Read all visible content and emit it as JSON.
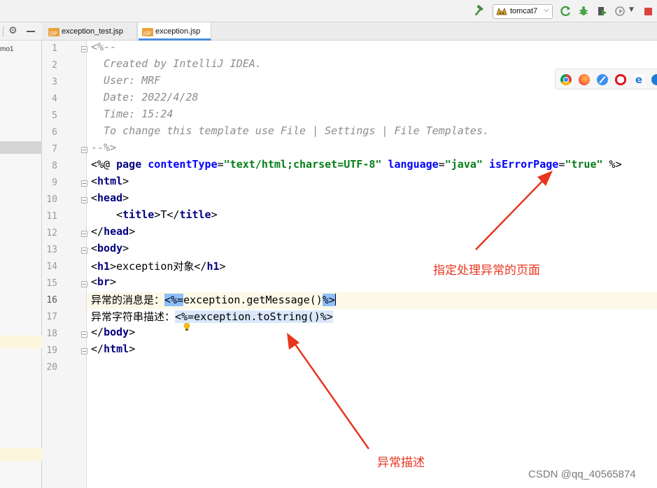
{
  "toolbar": {
    "run_config": "tomcat7",
    "icons": [
      "build-hammer-icon",
      "tomcat-icon",
      "rerun-icon",
      "debug-icon",
      "coverage-icon",
      "profile-icon",
      "stop-icon"
    ],
    "stop_color": "#d9453d"
  },
  "project_panel": {
    "item_fragment": "mo1"
  },
  "tabs": [
    {
      "label": "exception_test.jsp",
      "active": false
    },
    {
      "label": "exception.jsp",
      "active": true
    }
  ],
  "editor": {
    "line_numbers": [
      "1",
      "2",
      "3",
      "4",
      "5",
      "6",
      "7",
      "8",
      "9",
      "10",
      "11",
      "12",
      "13",
      "14",
      "15",
      "16",
      "17",
      "18",
      "19",
      "20"
    ],
    "current_line": "16",
    "lines": {
      "l1": "<%--",
      "l2": "  Created by IntelliJ IDEA.",
      "l3": "  User: MRF",
      "l4": "  Date: 2022/4/28",
      "l5": "  Time: 15:24",
      "l6": "  To change this template use File | Settings | File Templates.",
      "l7": "--%>",
      "l8": {
        "open": "<%@ ",
        "kw": "page",
        "a1": " contentType",
        "eq1": "=",
        "v1": "\"text/html;charset=UTF-8\"",
        "a2": " language",
        "eq2": "=",
        "v2": "\"java\"",
        "a3": " isErrorPage",
        "eq3": "=",
        "v3": "\"true\"",
        "close": " %>"
      },
      "l9": {
        "lt": "<",
        "tag": "html",
        "gt": ">"
      },
      "l10": {
        "lt": "<",
        "tag": "head",
        "gt": ">"
      },
      "l11": {
        "indent": "    ",
        "lt": "<",
        "tag": "title",
        "gt": ">",
        "text": "T",
        "lt2": "</",
        "tag2": "title",
        "gt2": ">"
      },
      "l12": {
        "lt": "</",
        "tag": "head",
        "gt": ">"
      },
      "l13": {
        "lt": "<",
        "tag": "body",
        "gt": ">"
      },
      "l14": {
        "lt": "<",
        "tag": "h1",
        "gt": ">",
        "text": "exception对象",
        "lt2": "</",
        "tag2": "h1",
        "gt2": ">"
      },
      "l15": {
        "lt": "<",
        "tag": "br",
        "gt": ">"
      },
      "l16": {
        "text": "异常的消息是：",
        "open": "<%=",
        "expr": "exception.getMessage()",
        "close": "%>"
      },
      "l17": {
        "text": "异常字符串描述：",
        "open": "<%=",
        "expr": "exception.toString()",
        "close": "%>"
      },
      "l18": {
        "lt": "</",
        "tag": "body",
        "gt": ">"
      },
      "l19": {
        "lt": "</",
        "tag": "html",
        "gt": ">"
      }
    }
  },
  "browser_icons": [
    "chrome-icon",
    "firefox-icon",
    "safari-icon",
    "opera-icon",
    "edge-icon",
    "ie-icon"
  ],
  "annotations": {
    "error_page_note": "指定处理异常的页面",
    "description_note": "异常描述",
    "color": "#e8361f"
  },
  "watermark": "CSDN @qq_40565874"
}
